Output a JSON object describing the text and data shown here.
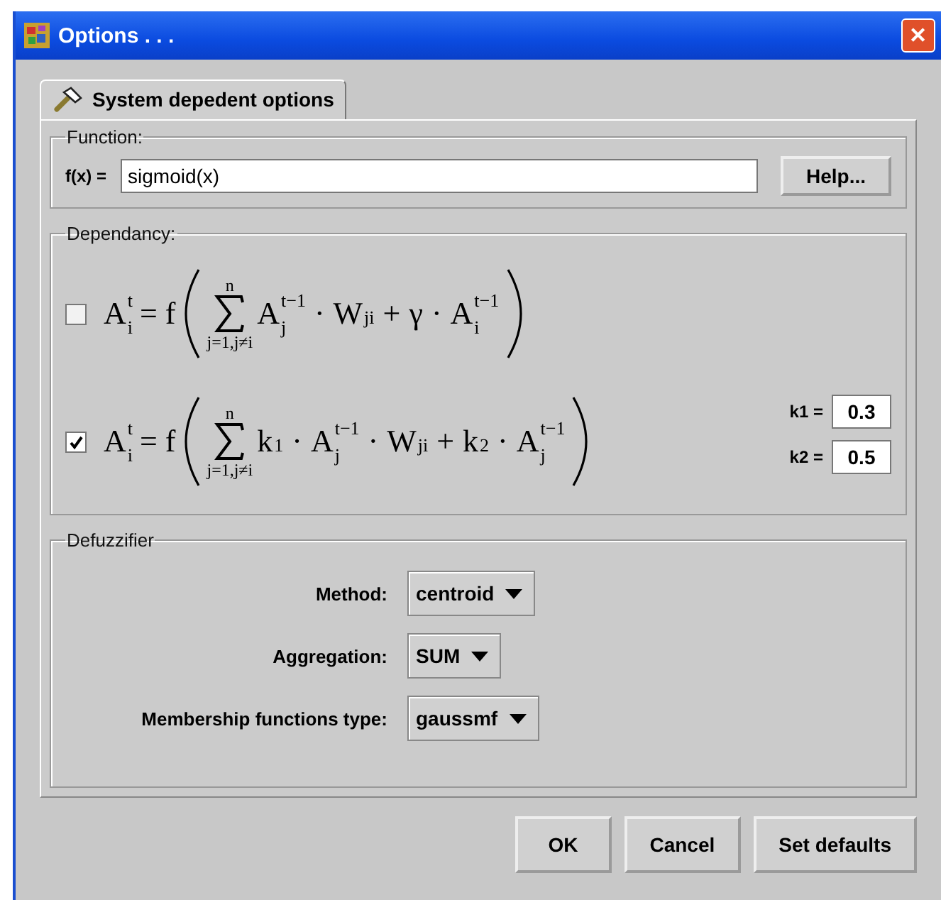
{
  "window": {
    "title": "Options . . .",
    "close": "✕"
  },
  "tabs": [
    {
      "label": "System depedent options",
      "selected": true
    }
  ],
  "function": {
    "legend": "Function:",
    "label": "f(x) =",
    "value": "sigmoid(x)",
    "help_button": "Help..."
  },
  "dependancy": {
    "legend": "Dependancy:",
    "formulas": [
      {
        "checked": false,
        "lhs": {
          "base": "A",
          "sup": "t",
          "sub": "i"
        },
        "eq": "= f",
        "sum": {
          "upper": "n",
          "lower": "j=1,j≠i"
        },
        "terms": [
          {
            "base": "A",
            "sup": "t−1",
            "sub": "j"
          },
          {
            "op": "·"
          },
          {
            "base": "W",
            "sub": "ji"
          },
          {
            "op": "+"
          },
          {
            "base": "γ"
          },
          {
            "op": "·"
          },
          {
            "base": "A",
            "sup": "t−1",
            "sub": "i"
          }
        ]
      },
      {
        "checked": true,
        "lhs": {
          "base": "A",
          "sup": "t",
          "sub": "i"
        },
        "eq": "= f",
        "sum": {
          "upper": "n",
          "lower": "j=1,j≠i"
        },
        "terms": [
          {
            "base": "k",
            "sub": "1"
          },
          {
            "op": "·"
          },
          {
            "base": "A",
            "sup": "t−1",
            "sub": "j"
          },
          {
            "op": "·"
          },
          {
            "base": "W",
            "sub": "ji"
          },
          {
            "op": "+"
          },
          {
            "base": "k",
            "sub": "2"
          },
          {
            "op": "·"
          },
          {
            "base": "A",
            "sup": "t−1",
            "sub": "j"
          }
        ]
      }
    ],
    "params": [
      {
        "label": "k1 =",
        "value": "0.3"
      },
      {
        "label": "k2 =",
        "value": "0.5"
      }
    ]
  },
  "defuzzifier": {
    "legend": "Defuzzifier",
    "fields": [
      {
        "label": "Method:",
        "value": "centroid"
      },
      {
        "label": "Aggregation:",
        "value": "SUM"
      },
      {
        "label": "Membership functions type:",
        "value": "gaussmf"
      }
    ]
  },
  "buttons": [
    "OK",
    "Cancel",
    "Set defaults"
  ]
}
